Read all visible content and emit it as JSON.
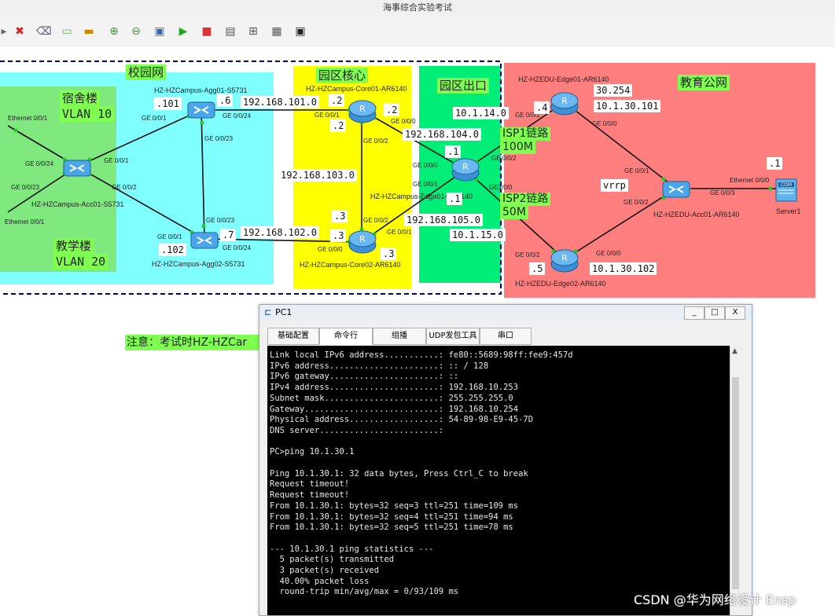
{
  "window": {
    "title": "海事综合实验考试"
  },
  "toolbar": {
    "icons": [
      "arrow-icon",
      "delete-icon",
      "eraser-icon",
      "note-icon",
      "rect-icon",
      "zoom-in-icon",
      "zoom-out-icon",
      "fit-icon",
      "start-icon",
      "stop-icon",
      "capture-icon",
      "topology-icon",
      "grid-icon",
      "console-icon"
    ]
  },
  "zones": {
    "campus": "校园网",
    "dorm": "宿舍楼",
    "dorm_vlan": "VLAN 10",
    "teach": "教学楼",
    "teach_vlan": "VLAN 20",
    "core": "园区核心",
    "exit": "园区出口",
    "edu": "教育公网"
  },
  "devices": {
    "agg01": "HZ-HZCampus-Agg01-S5731",
    "agg02": "HZ-HZCampus-Agg02-S5731",
    "acc01": "HZ-HZCampus-Acc01-S5731",
    "core01": "HZ-HZCampus-Core01-AR6140",
    "core02": "HZ-HZCampus-Core02-AR6140",
    "edge01": "HZ-HZCampus-Edge01-AR6140",
    "edu_edge01": "HZ-HZEDU-Edge01-AR6140",
    "edu_edge02": "HZ-HZEDU-Edge02-AR6140",
    "edu_acc01": "HZ-HZEDU-Acc01-AR6140",
    "server1": "Server1"
  },
  "ports": {
    "eth_001_a": "Ethernet 0/0/1",
    "eth_001_b": "Ethernet 0/0/1",
    "ge024_acc": "GE 0/0/24",
    "ge023_acc": "GE 0/0/23",
    "ge001_acc": "GE 0/0/1",
    "ge002_acc": "GE 0/0/2",
    "ge001_agg1": "GE 0/0/1",
    "ge024_agg1": "GE 0/0/24",
    "ge023_agg1": "GE 0/0/23",
    "ge023_agg2": "GE 0/0/23",
    "ge001_agg2": "GE 0/0/1",
    "ge024_agg2": "GE 0/0/24",
    "ge001_core1": "GE 0/0/1",
    "ge000_core1": "GE 0/0/0",
    "ge002_core1": "GE 0/0/2",
    "ge002_core2": "GE 0/0/2",
    "ge000_core2": "GE 0/0/0",
    "ge001_core2": "GE 0/0/1",
    "ge000_edge": "GE 0/0/0",
    "ge001_edge": "GE 0/0/1",
    "ge002_edge": "GE 0/0/2",
    "ge300_edge": "GE3/0/0",
    "ge002_e1": "GE 0/0/2",
    "ge000_e1": "GE 0/0/0",
    "ge001_acc2": "GE 0/0/1",
    "ge002_acc2": "GE 0/0/2",
    "ge003_acc2": "GE 0/0/3",
    "eth000_srv": "Ethernet 0/0/0",
    "ge002_e2": "GE 0/0/2",
    "ge000_e2": "GE 0/0/0"
  },
  "ips": {
    "agg1_101": ".101",
    "agg1_6": ".6",
    "net_101": "192.168.101.0",
    "core1_2a": ".2",
    "core1_2b": ".2",
    "core1_2c": ".2",
    "net_104": "192.168.104.0",
    "net_103": "192.168.103.0",
    "core2_3a": ".3",
    "core2_3b": ".3",
    "core2_3c": ".3",
    "agg2_102": ".102",
    "agg2_7": ".7",
    "net_102": "192.168.102.0",
    "net_105": "192.168.105.0",
    "edge_1a": ".1",
    "edge_1b": ".1",
    "net_14": "10.1.14.0",
    "net_15": "10.1.15.0",
    "e1_4": ".4",
    "e1_30254": "30.254",
    "e1_30101": "10.1.30.101",
    "vrrp": "vrrp",
    "srv_1": ".1",
    "e2_5": ".5",
    "e2_30102": "10.1.30.102"
  },
  "links": {
    "isp1": "ISP1链路",
    "isp1_bw": "100M",
    "isp2": "ISP2链路",
    "isp2_bw": "50M"
  },
  "note": "注意：考试时HZ-HZCar",
  "pc_window": {
    "title": "PC1",
    "controls": [
      "_",
      "□",
      "X"
    ],
    "tabs": [
      "基础配置",
      "命令行",
      "组播",
      "UDP发包工具",
      "串口"
    ],
    "active_tab": 1,
    "terminal_lines": [
      "Link local IPv6 address...........: fe80::5689:98ff:fee9:457d",
      "IPv6 address......................: :: / 128",
      "IPv6 gateway......................: ::",
      "IPv4 address......................: 192.168.10.253",
      "Subnet mask.......................: 255.255.255.0",
      "Gateway...........................: 192.168.10.254",
      "Physical address..................: 54-89-98-E9-45-7D",
      "DNS server........................: ",
      "",
      "PC>ping 10.1.30.1",
      "",
      "Ping 10.1.30.1: 32 data bytes, Press Ctrl_C to break",
      "Request timeout!",
      "Request timeout!",
      "From 10.1.30.1: bytes=32 seq=3 ttl=251 time=109 ms",
      "From 10.1.30.1: bytes=32 seq=4 ttl=251 time=94 ms",
      "From 10.1.30.1: bytes=32 seq=5 ttl=251 time=78 ms",
      "",
      "--- 10.1.30.1 ping statistics ---",
      "  5 packet(s) transmitted",
      "  3 packet(s) received",
      "  40.00% packet loss",
      "  round-trip min/avg/max = 0/93/109 ms"
    ]
  },
  "watermark": "CSDN @华为网络设计 Ensp",
  "colors": {
    "campus": "#7fffff",
    "dorm": "#7fe87f",
    "core": "#ffff00",
    "exit": "#00ee77",
    "edu": "#ff7f7f",
    "label_green": "#7fff4f",
    "terminal_bg": "#000000"
  }
}
